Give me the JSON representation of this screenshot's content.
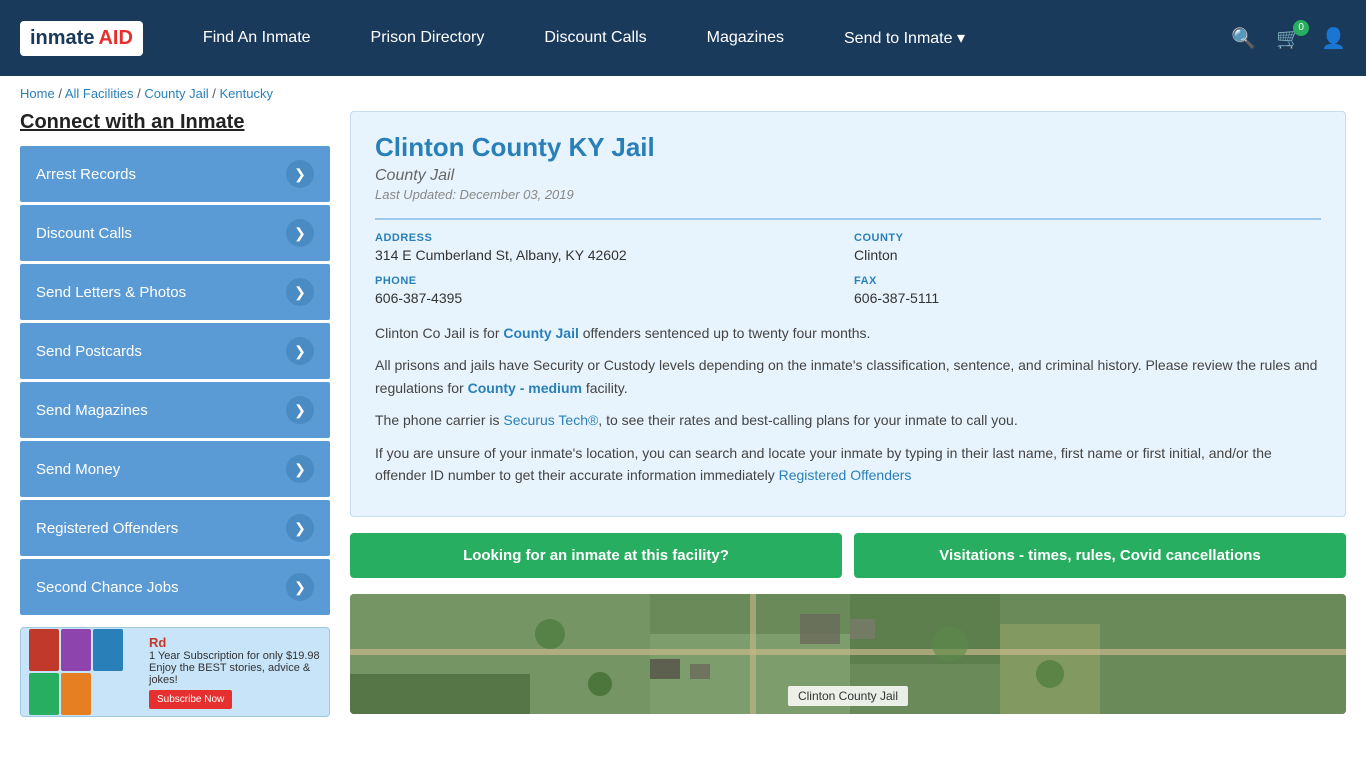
{
  "header": {
    "logo_text": "inmate",
    "logo_aid": "AID",
    "nav_items": [
      {
        "label": "Find An Inmate",
        "id": "find-inmate"
      },
      {
        "label": "Prison Directory",
        "id": "prison-directory"
      },
      {
        "label": "Discount Calls",
        "id": "discount-calls"
      },
      {
        "label": "Magazines",
        "id": "magazines"
      },
      {
        "label": "Send to Inmate ▾",
        "id": "send-to-inmate"
      }
    ],
    "cart_count": "0"
  },
  "breadcrumb": {
    "items": [
      "Home",
      "All Facilities",
      "County Jail",
      "Kentucky"
    ]
  },
  "sidebar": {
    "title": "Connect with an Inmate",
    "menu_items": [
      {
        "label": "Arrest Records",
        "id": "arrest-records"
      },
      {
        "label": "Discount Calls",
        "id": "discount-calls"
      },
      {
        "label": "Send Letters & Photos",
        "id": "send-letters"
      },
      {
        "label": "Send Postcards",
        "id": "send-postcards"
      },
      {
        "label": "Send Magazines",
        "id": "send-magazines"
      },
      {
        "label": "Send Money",
        "id": "send-money"
      },
      {
        "label": "Registered Offenders",
        "id": "registered-offenders"
      },
      {
        "label": "Second Chance Jobs",
        "id": "second-chance-jobs"
      }
    ]
  },
  "ad": {
    "tagline": "1 Year Subscription for only $19.98",
    "description": "Enjoy the BEST stories, advice & jokes!",
    "button_label": "Subscribe Now"
  },
  "facility": {
    "title": "Clinton County KY Jail",
    "subtitle": "County Jail",
    "last_updated": "Last Updated: December 03, 2019",
    "address_label": "ADDRESS",
    "address_value": "314 E Cumberland St, Albany, KY 42602",
    "county_label": "COUNTY",
    "county_value": "Clinton",
    "phone_label": "PHONE",
    "phone_value": "606-387-4395",
    "fax_label": "FAX",
    "fax_value": "606-387-5111",
    "description_1": "Clinton Co Jail is for County Jail offenders sentenced up to twenty four months.",
    "description_2": "All prisons and jails have Security or Custody levels depending on the inmate's classification, sentence, and criminal history. Please review the rules and regulations for County - medium facility.",
    "description_3": "The phone carrier is Securus Tech®, to see their rates and best-calling plans for your inmate to call you.",
    "description_4": "If you are unsure of your inmate's location, you can search and locate your inmate by typing in their last name, first name or first initial, and/or the offender ID number to get their accurate information immediately Registered Offenders",
    "btn_inmate": "Looking for an inmate at this facility?",
    "btn_visitation": "Visitations - times, rules, Covid cancellations",
    "map_label": "Clinton County Jail"
  }
}
